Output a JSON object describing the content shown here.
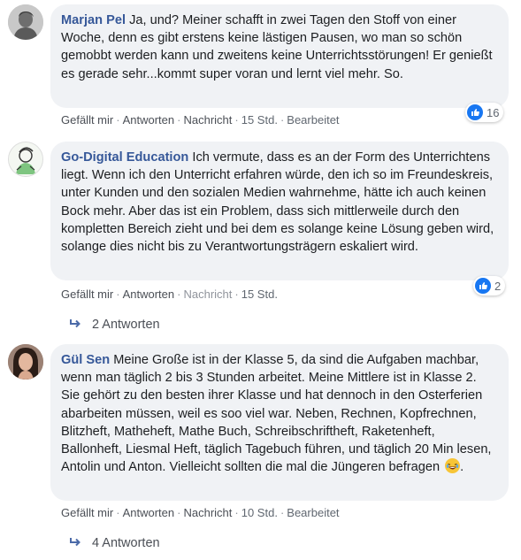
{
  "comments": [
    {
      "author": "Marjan Pel",
      "text": "Ja, und? Meiner schafft in zwei Tagen den Stoff von einer Woche, denn es gibt erstens keine lästigen Pausen, wo man so schön gemobbt werden kann und zweitens keine Unterrichtsstörungen! Er genießt es gerade sehr...kommt super voran und lernt viel mehr. So.",
      "actions": {
        "like": "Gefällt mir",
        "reply": "Antworten",
        "message": "Nachricht",
        "time": "15 Std.",
        "edited": "Bearbeitet"
      },
      "reaction_count": "16"
    },
    {
      "author": "Go-Digital Education",
      "text": "Ich vermute, dass es an der Form des Unterrichtens liegt. Wenn ich den Unterricht erfahren würde, den ich so im Freundeskreis, unter Kunden und den sozialen Medien wahrnehme, hätte ich auch keinen Bock mehr. Aber das ist ein Problem, dass sich mittlerweile durch den kompletten Bereich zieht und bei dem es solange keine Lösung geben wird, solange dies nicht bis zu Verantwortungsträgern eskaliert wird.",
      "actions": {
        "like": "Gefällt mir",
        "reply": "Antworten",
        "message": "Nachricht",
        "time": "15 Std."
      },
      "reaction_count": "2",
      "replies": "2 Antworten"
    },
    {
      "author": "Gül Sen",
      "text": "Meine Große ist in der Klasse 5, da sind die Aufgaben machbar, wenn man täglich 2 bis 3 Stunden arbeitet. Meine Mittlere ist in Klasse 2. Sie gehört zu den besten ihrer Klasse und hat dennoch in den Osterferien abarbeiten müssen, weil es soo viel war. Neben, Rechnen, Kopfrechnen, Blitzheft, Matheheft, Mathe Buch, Schreibschriftheft, Raketenheft, Ballonheft, Liesmal Heft, täglich Tagebuch führen, und täglich 20 Min lesen, Antolin und Anton. Vielleicht sollten die mal die Jüngeren befragen",
      "emoji": "laughing-emoji",
      "actions": {
        "like": "Gefällt mir",
        "reply": "Antworten",
        "message": "Nachricht",
        "time": "10 Std.",
        "edited": "Bearbeitet"
      },
      "replies": "4 Antworten"
    }
  ],
  "colors": {
    "author": "#365899",
    "bubble": "#f0f2f5",
    "like": "#1877f2"
  }
}
